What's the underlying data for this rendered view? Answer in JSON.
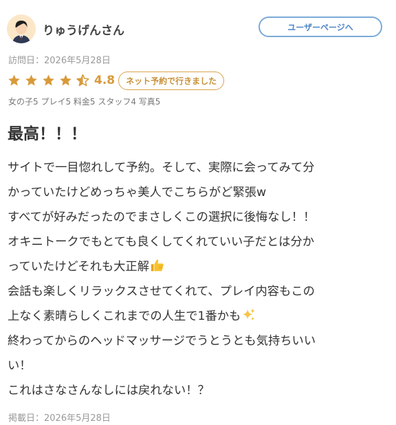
{
  "user": {
    "name": "りゅうげんさん",
    "page_button_label": "ユーザーページへ"
  },
  "visit_date": "訪問日：2026年5月28日",
  "rating": {
    "stars": 4.5,
    "value": "4.8",
    "badge": "ネット予約で行きました",
    "star_color": "#d89a3a"
  },
  "scores_text": "女の子5 プレイ5 料金5 スタッフ4 写真5",
  "review": {
    "title": "最高！！！",
    "lines": [
      "サイトで一目惚れして予約。そして、実際に会ってみて分",
      "かっていたけどめっちゃ美人でこちらがど緊張w",
      "すべてが好みだったのでまさしくこの選択に後悔なし！！",
      "オキニトークでもとても良くしてくれていい子だとは分か",
      "っていたけどそれも大正解",
      "会話も楽しくリラックスさせてくれて、プレイ内容もこの",
      "上なく素晴らしくこれまでの人生で1番かも",
      "終わってからのヘッドマッサージでうとうとも気持ちいい",
      "い！",
      "これはさなさんなしには戻れない！？"
    ],
    "emojis": {
      "thumbs_up": "thumbs-up-icon",
      "sparkles": "sparkles-icon"
    }
  },
  "post_date": "掲載日：2026年5月28日"
}
